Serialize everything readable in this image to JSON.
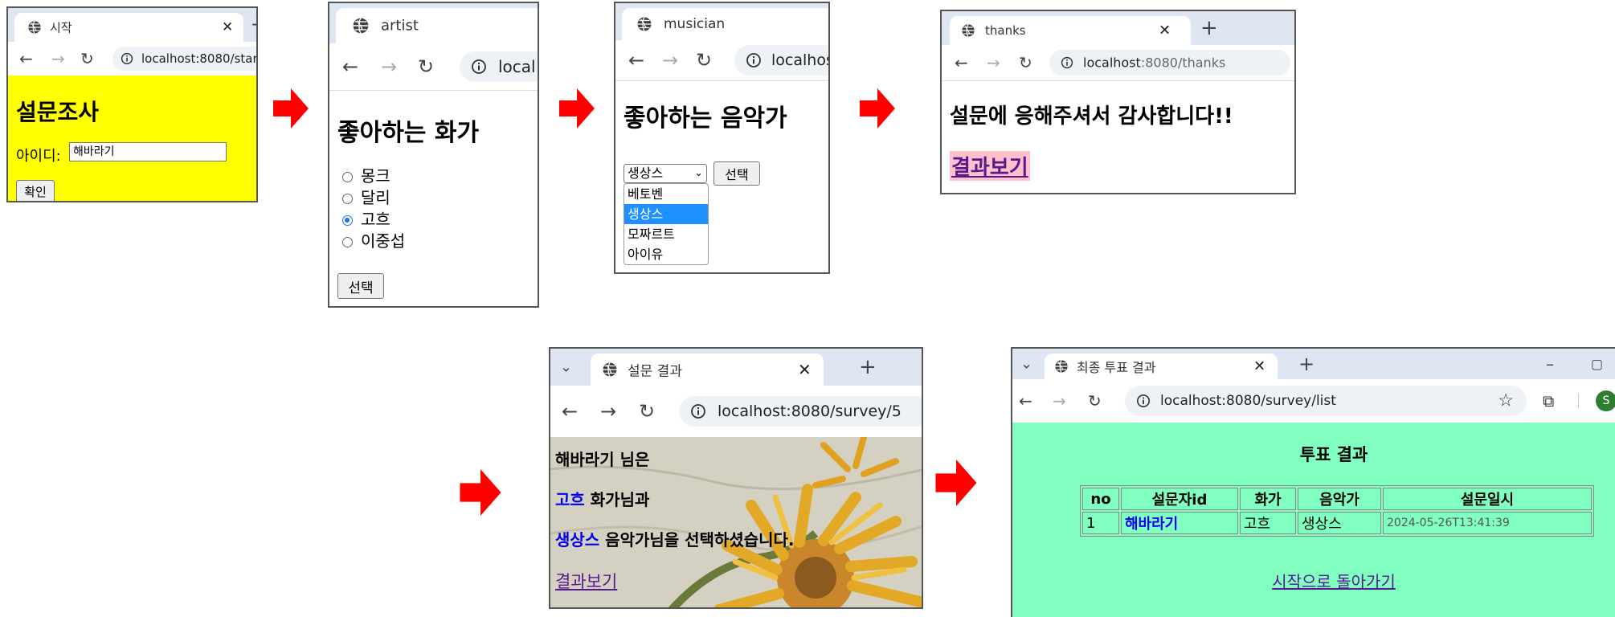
{
  "step1": {
    "tab_title": "시작",
    "url": "localhost:8080/start",
    "heading": "설문조사",
    "id_label": "아이디:",
    "id_value": "해바라기",
    "confirm_label": "확인",
    "bg_color": "#ffff00"
  },
  "step2": {
    "tab_title": "artist",
    "url": "local",
    "heading": "좋아하는 화가",
    "options": [
      "몽크",
      "달리",
      "고흐",
      "이중섭"
    ],
    "selected": "고흐",
    "select_label": "선택"
  },
  "step3": {
    "tab_title": "musician",
    "url": "localhos",
    "heading": "좋아하는 음악가",
    "select_value": "생상스",
    "options": [
      "베토벤",
      "생상스",
      "모짜르트",
      "아이유"
    ],
    "highlighted": "생상스",
    "select_label": "선택"
  },
  "step4": {
    "tab_title": "thanks",
    "url_host": "localhost",
    "url_path": ":8080/thanks",
    "message": "설문에 응해주셔서 감사합니다!!",
    "link": "결과보기"
  },
  "step5": {
    "tab_title": "설문 결과",
    "url": "localhost:8080/survey/5",
    "line1": "해바라기 님은",
    "artist": "고흐",
    "line2_suffix": " 화가님과",
    "musician": "생상스",
    "line3_suffix": " 음악가님을 선택하셨습니다.",
    "link": "결과보기"
  },
  "step6": {
    "tab_title": "최종 투표 결과",
    "url": "localhost:8080/survey/list",
    "title": "투표 결과",
    "columns": [
      "no",
      "설문자id",
      "화가",
      "음악가",
      "설문일시"
    ],
    "rows": [
      [
        "1",
        "해바라기",
        "고흐",
        "생상스",
        "2024-05-26T13:41:39"
      ]
    ],
    "back_link": "시작으로 돌아가기",
    "avatar_letter": "S",
    "bg_color": "#80ffc0"
  },
  "icons": {
    "back": "back-arrow-icon",
    "forward": "forward-arrow-icon",
    "reload": "reload-icon",
    "info": "info-icon",
    "globe": "globe-icon",
    "close": "close-icon",
    "new_tab": "plus-icon",
    "flow_arrow": "red-right-arrow-icon"
  },
  "colors": {
    "arrow": "#ff0000",
    "link_blue": "#0000ee",
    "highlight": "#1e90ff"
  }
}
